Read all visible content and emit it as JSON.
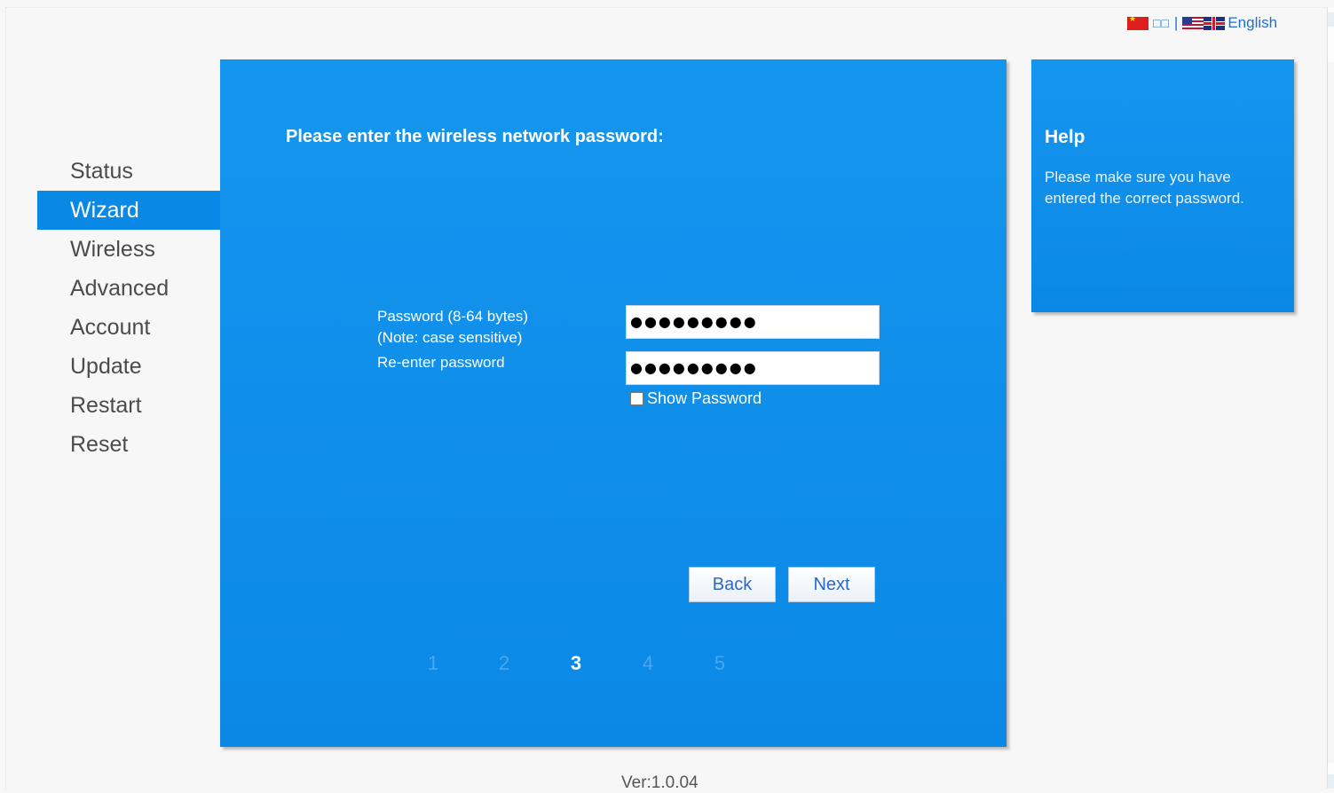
{
  "language": {
    "chinese_label": "□□",
    "separator": "|",
    "english_label": "English"
  },
  "sidebar": {
    "items": [
      {
        "label": "Status"
      },
      {
        "label": "Wizard"
      },
      {
        "label": "Wireless"
      },
      {
        "label": "Advanced"
      },
      {
        "label": "Account"
      },
      {
        "label": "Update"
      },
      {
        "label": "Restart"
      },
      {
        "label": "Reset"
      }
    ],
    "active": "Wizard"
  },
  "main": {
    "title": "Please enter the wireless network password:",
    "password_label": "Password (8-64 bytes)",
    "password_note": "(Note: case sensitive)",
    "password_value": "●●●●●●●●●",
    "reenter_label": "Re-enter password",
    "reenter_value": "●●●●●●●●●",
    "show_password_label": "Show Password",
    "show_password_checked": false,
    "back_label": "Back",
    "next_label": "Next",
    "steps": [
      "1",
      "2",
      "3",
      "4",
      "5"
    ],
    "current_step": "3"
  },
  "help": {
    "title": "Help",
    "text": "Please make sure you have entered the correct password."
  },
  "footer": {
    "version": "Ver:1.0.04"
  },
  "colors": {
    "panel_blue": "#0b88e6",
    "active_nav": "#0a88e6",
    "link_blue": "#1e6fd6"
  }
}
